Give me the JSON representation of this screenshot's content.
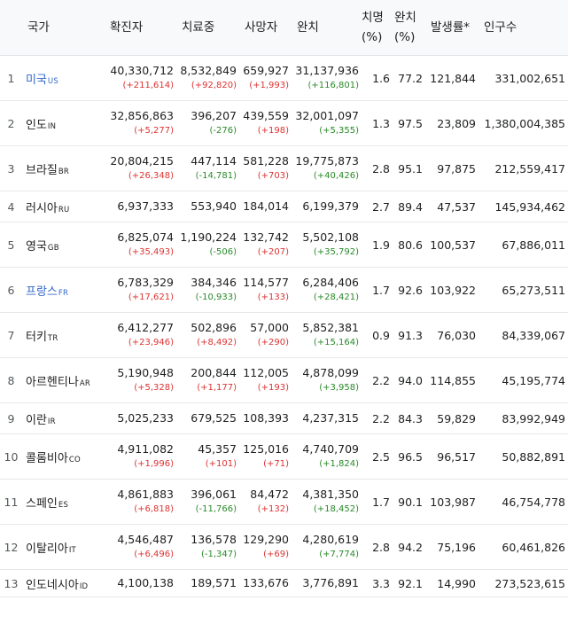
{
  "headers": {
    "country": "국가",
    "confirmed": "확진자",
    "treating": "치료중",
    "deaths": "사망자",
    "recovered": "완치",
    "cfr_line1": "치명",
    "cfr_line2": "(%)",
    "rr_line1": "완치",
    "rr_line2": "(%)",
    "incidence": "발생률*",
    "population": "인구수"
  },
  "rows": [
    {
      "rank": "1",
      "name": "미국",
      "code": "US",
      "link": true,
      "confirmed": "40,330,712",
      "confirmed_delta": "(+211,614)",
      "treating": "8,532,849",
      "treating_delta": "(+92,820)",
      "treating_dir": "up",
      "deaths": "659,927",
      "deaths_delta": "(+1,993)",
      "recovered": "31,137,936",
      "recovered_delta": "(+116,801)",
      "cfr": "1.6",
      "rr": "77.2",
      "incidence": "121,844",
      "population": "331,002,651"
    },
    {
      "rank": "2",
      "name": "인도",
      "code": "IN",
      "link": false,
      "confirmed": "32,856,863",
      "confirmed_delta": "(+5,277)",
      "treating": "396,207",
      "treating_delta": "(-276)",
      "treating_dir": "down",
      "deaths": "439,559",
      "deaths_delta": "(+198)",
      "recovered": "32,001,097",
      "recovered_delta": "(+5,355)",
      "cfr": "1.3",
      "rr": "97.5",
      "incidence": "23,809",
      "population": "1,380,004,385"
    },
    {
      "rank": "3",
      "name": "브라질",
      "code": "BR",
      "link": false,
      "confirmed": "20,804,215",
      "confirmed_delta": "(+26,348)",
      "treating": "447,114",
      "treating_delta": "(-14,781)",
      "treating_dir": "down",
      "deaths": "581,228",
      "deaths_delta": "(+703)",
      "recovered": "19,775,873",
      "recovered_delta": "(+40,426)",
      "cfr": "2.8",
      "rr": "95.1",
      "incidence": "97,875",
      "population": "212,559,417"
    },
    {
      "rank": "4",
      "name": "러시아",
      "code": "RU",
      "link": false,
      "confirmed": "6,937,333",
      "confirmed_delta": "",
      "treating": "553,940",
      "treating_delta": "",
      "treating_dir": "",
      "deaths": "184,014",
      "deaths_delta": "",
      "recovered": "6,199,379",
      "recovered_delta": "",
      "cfr": "2.7",
      "rr": "89.4",
      "incidence": "47,537",
      "population": "145,934,462"
    },
    {
      "rank": "5",
      "name": "영국",
      "code": "GB",
      "link": false,
      "confirmed": "6,825,074",
      "confirmed_delta": "(+35,493)",
      "treating": "1,190,224",
      "treating_delta": "(-506)",
      "treating_dir": "down",
      "deaths": "132,742",
      "deaths_delta": "(+207)",
      "recovered": "5,502,108",
      "recovered_delta": "(+35,792)",
      "cfr": "1.9",
      "rr": "80.6",
      "incidence": "100,537",
      "population": "67,886,011"
    },
    {
      "rank": "6",
      "name": "프랑스",
      "code": "FR",
      "link": true,
      "confirmed": "6,783,329",
      "confirmed_delta": "(+17,621)",
      "treating": "384,346",
      "treating_delta": "(-10,933)",
      "treating_dir": "down",
      "deaths": "114,577",
      "deaths_delta": "(+133)",
      "recovered": "6,284,406",
      "recovered_delta": "(+28,421)",
      "cfr": "1.7",
      "rr": "92.6",
      "incidence": "103,922",
      "population": "65,273,511"
    },
    {
      "rank": "7",
      "name": "터키",
      "code": "TR",
      "link": false,
      "confirmed": "6,412,277",
      "confirmed_delta": "(+23,946)",
      "treating": "502,896",
      "treating_delta": "(+8,492)",
      "treating_dir": "up",
      "deaths": "57,000",
      "deaths_delta": "(+290)",
      "recovered": "5,852,381",
      "recovered_delta": "(+15,164)",
      "cfr": "0.9",
      "rr": "91.3",
      "incidence": "76,030",
      "population": "84,339,067"
    },
    {
      "rank": "8",
      "name": "아르헨티나",
      "code": "AR",
      "link": false,
      "confirmed": "5,190,948",
      "confirmed_delta": "(+5,328)",
      "treating": "200,844",
      "treating_delta": "(+1,177)",
      "treating_dir": "up",
      "deaths": "112,005",
      "deaths_delta": "(+193)",
      "recovered": "4,878,099",
      "recovered_delta": "(+3,958)",
      "cfr": "2.2",
      "rr": "94.0",
      "incidence": "114,855",
      "population": "45,195,774"
    },
    {
      "rank": "9",
      "name": "이란",
      "code": "IR",
      "link": false,
      "confirmed": "5,025,233",
      "confirmed_delta": "",
      "treating": "679,525",
      "treating_delta": "",
      "treating_dir": "",
      "deaths": "108,393",
      "deaths_delta": "",
      "recovered": "4,237,315",
      "recovered_delta": "",
      "cfr": "2.2",
      "rr": "84.3",
      "incidence": "59,829",
      "population": "83,992,949"
    },
    {
      "rank": "10",
      "name": "콜롬비아",
      "code": "CO",
      "link": false,
      "confirmed": "4,911,082",
      "confirmed_delta": "(+1,996)",
      "treating": "45,357",
      "treating_delta": "(+101)",
      "treating_dir": "up",
      "deaths": "125,016",
      "deaths_delta": "(+71)",
      "recovered": "4,740,709",
      "recovered_delta": "(+1,824)",
      "cfr": "2.5",
      "rr": "96.5",
      "incidence": "96,517",
      "population": "50,882,891"
    },
    {
      "rank": "11",
      "name": "스페인",
      "code": "ES",
      "link": false,
      "confirmed": "4,861,883",
      "confirmed_delta": "(+6,818)",
      "treating": "396,061",
      "treating_delta": "(-11,766)",
      "treating_dir": "down",
      "deaths": "84,472",
      "deaths_delta": "(+132)",
      "recovered": "4,381,350",
      "recovered_delta": "(+18,452)",
      "cfr": "1.7",
      "rr": "90.1",
      "incidence": "103,987",
      "population": "46,754,778"
    },
    {
      "rank": "12",
      "name": "이탈리아",
      "code": "IT",
      "link": false,
      "confirmed": "4,546,487",
      "confirmed_delta": "(+6,496)",
      "treating": "136,578",
      "treating_delta": "(-1,347)",
      "treating_dir": "down",
      "deaths": "129,290",
      "deaths_delta": "(+69)",
      "recovered": "4,280,619",
      "recovered_delta": "(+7,774)",
      "cfr": "2.8",
      "rr": "94.2",
      "incidence": "75,196",
      "population": "60,461,826"
    },
    {
      "rank": "13",
      "name": "인도네시아",
      "code": "ID",
      "link": false,
      "confirmed": "4,100,138",
      "confirmed_delta": "",
      "treating": "189,571",
      "treating_delta": "",
      "treating_dir": "",
      "deaths": "133,676",
      "deaths_delta": "",
      "recovered": "3,776,891",
      "recovered_delta": "",
      "cfr": "3.3",
      "rr": "92.1",
      "incidence": "14,990",
      "population": "273,523,615"
    }
  ],
  "colors": {
    "link": "#3366cc",
    "increase": "#dd3333",
    "decrease": "#2a8a2a",
    "header_bg": "#f8f9fa"
  }
}
